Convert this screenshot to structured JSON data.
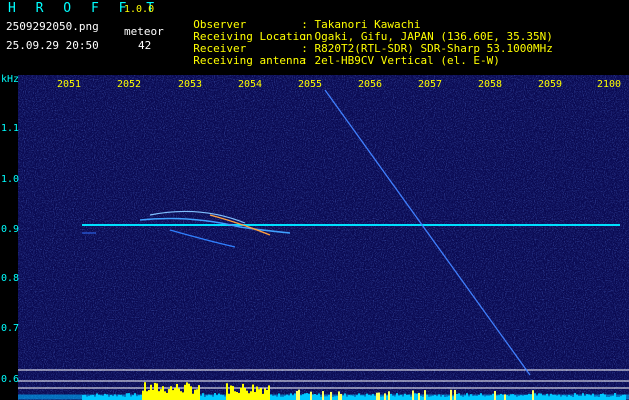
{
  "header": {
    "app_title": "H R O F F T",
    "version": "1.0.0",
    "file_name": "2509292050.png",
    "date_time": "25.09.29 20:50",
    "meteor_label": "meteor",
    "meteor_count": "42"
  },
  "info": [
    {
      "key": "Observer",
      "value": ": Takanori Kawachi"
    },
    {
      "key": "Receiving Location",
      "value": ": Ogaki, Gifu, JAPAN (136.60E, 35.35N)"
    },
    {
      "key": "Receiver",
      "value": ": R820T2(RTL-SDR) SDR-Sharp 53.1000MHz"
    },
    {
      "key": "Receiving antenna",
      "value": ": 2el-HB9CV Vertical (el. E-W)"
    }
  ],
  "axis": {
    "unit": "kHz",
    "x_ticks": [
      "2051",
      "2052",
      "2053",
      "2054",
      "2055",
      "2056",
      "2057",
      "2058",
      "2059",
      "2100"
    ],
    "y_ticks": [
      "1.1",
      "1.0",
      "0.9",
      "0.8",
      "0.7",
      "0.6"
    ]
  },
  "colors": {
    "background": "#0a0a52",
    "carrier": "#00e0ff",
    "text_yellow": "#ffff00",
    "text_cyan": "#00ffff"
  }
}
